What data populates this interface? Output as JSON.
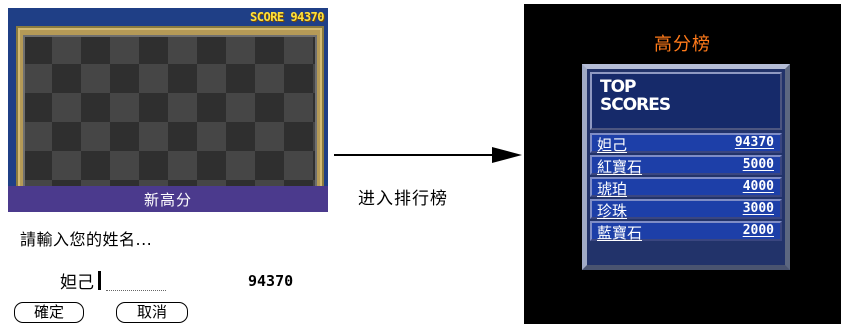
{
  "game": {
    "score_display": "SCORE 94370"
  },
  "dialog": {
    "title": "新高分",
    "prompt": "請輸入您的姓名...",
    "name_value": "妲己",
    "score": "94370",
    "ok_label": "確定",
    "cancel_label": "取消"
  },
  "arrow": {
    "caption": "进入排行榜"
  },
  "high_scores": {
    "title": "高分榜",
    "header": [
      "TOP",
      "SCORES"
    ],
    "entries": [
      {
        "name": "妲己",
        "score": "94370"
      },
      {
        "name": "紅寶石",
        "score": "5000"
      },
      {
        "name": "琥珀",
        "score": "4000"
      },
      {
        "name": "珍珠",
        "score": "3000"
      },
      {
        "name": "藍寶石",
        "score": "2000"
      }
    ]
  },
  "colors": {
    "dialog_title_bar": "#4b3a8d",
    "game_background": "#1f3f86",
    "score_text": "#ffe23a",
    "hs_title": "#ff7a1a",
    "hs_row": "#1d3fa8"
  }
}
